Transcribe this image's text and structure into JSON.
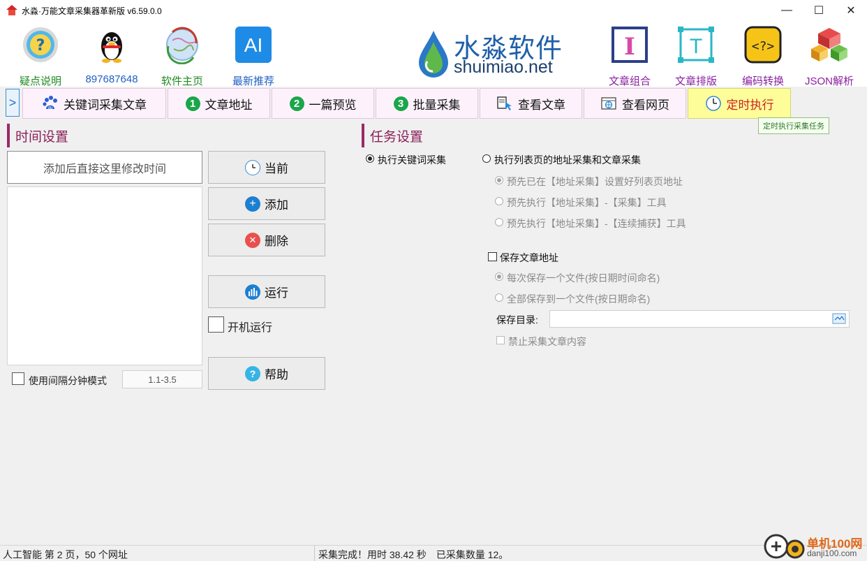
{
  "window": {
    "title": "水淼·万能文章采集器革新版 v6.59.0.0",
    "minimize": "—",
    "maximize": "☐",
    "close": "✕"
  },
  "toolbar": {
    "left_tools": [
      {
        "label": "疑点说明",
        "icon": "question-icon"
      },
      {
        "label": "897687648",
        "icon": "qq-penguin-icon"
      },
      {
        "label": "软件主页",
        "icon": "globe-home-icon"
      },
      {
        "label": "最新推荐",
        "icon": "ai-icon",
        "icon_text": "AI"
      }
    ],
    "logo": {
      "cn": "水淼软件",
      "en": "shuimiao.net"
    },
    "right_tools": [
      {
        "label": "文章组合",
        "icon": "article-combine-icon",
        "icon_text": "I"
      },
      {
        "label": "文章排版",
        "icon": "article-layout-icon",
        "icon_text": "T"
      },
      {
        "label": "编码转换",
        "icon": "encoding-icon",
        "icon_text": "<?>"
      },
      {
        "label": "JSON解析",
        "icon": "json-cubes-icon"
      }
    ]
  },
  "tabs": {
    "toggle": ">",
    "items": [
      {
        "label": "关键词采集文章",
        "icon": "baidu-paw-icon"
      },
      {
        "label": "文章地址",
        "icon": "number-1-icon",
        "num": "1"
      },
      {
        "label": "一篇预览",
        "icon": "number-2-icon",
        "num": "2"
      },
      {
        "label": "批量采集",
        "icon": "number-3-icon",
        "num": "3"
      },
      {
        "label": "查看文章",
        "icon": "view-article-icon"
      },
      {
        "label": "查看网页",
        "icon": "view-webpage-icon"
      },
      {
        "label": "定时执行",
        "icon": "clock-icon",
        "active": true
      }
    ],
    "tooltip": "定时执行采集任务"
  },
  "time_settings": {
    "title": "时间设置",
    "input_hint": "添加后直接这里修改时间",
    "buttons": {
      "current": "当前",
      "add": "添加",
      "delete": "删除",
      "run": "运行",
      "help": "帮助"
    },
    "startup_run_label": "开机运行",
    "interval_mode_label": "使用间隔分钟模式",
    "interval_value": "1.1-3.5"
  },
  "task_settings": {
    "title": "任务设置",
    "opt_keyword": "执行关键词采集",
    "opt_list": "执行列表页的地址采集和文章采集",
    "sub_options": [
      "预先已在【地址采集】设置好列表页地址",
      "预先执行【地址采集】-【采集】工具",
      "预先执行【地址采集】-【连续捕获】工具"
    ],
    "save_addresses_label": "保存文章地址",
    "save_options": [
      "每次保存一个文件(按日期时间命名)",
      "全部保存到一个文件(按日期命名)"
    ],
    "save_dir_label": "保存目录:",
    "save_dir_value": "",
    "disable_content_label": "禁止采集文章内容"
  },
  "status": {
    "left": "人工智能 第 2 页，50 个网址",
    "right": "采集完成！用时 38.42 秒　已采集数量 12。"
  },
  "watermark": {
    "cn": "单机100网",
    "en": "danji100.com"
  },
  "colors": {
    "section_accent": "#9a2a66",
    "active_tab_bg": "#fdfd9a",
    "active_tab_text": "#d0201f",
    "tab_bg": "#fdf2fb",
    "brand_blue": "#1f5fa8"
  }
}
